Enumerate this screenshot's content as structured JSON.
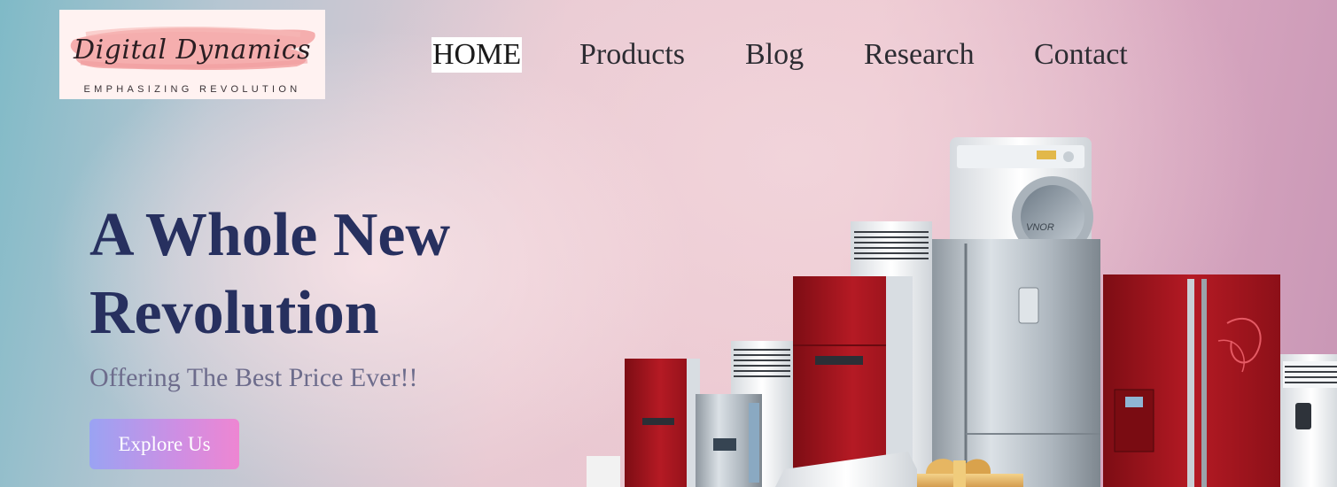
{
  "logo": {
    "script_text": "Digital Dynamics",
    "tagline": "EMPHASIZING REVOLUTION"
  },
  "nav": {
    "items": [
      {
        "label": "HOME",
        "active": true
      },
      {
        "label": "Products",
        "active": false
      },
      {
        "label": "Blog",
        "active": false
      },
      {
        "label": "Research",
        "active": false
      },
      {
        "label": "Contact",
        "active": false
      }
    ]
  },
  "hero": {
    "title_line1": "A Whole New",
    "title_line2": "Revolution",
    "subtitle": "Offering The Best Price Ever!!",
    "cta_label": "Explore Us"
  },
  "image": {
    "washer_brand": "VNOR"
  },
  "colors": {
    "title": "#27305f",
    "subtitle": "#6d6c8c",
    "cta_start": "#9aa3f3",
    "cta_end": "#ee86d2",
    "fridge_red": "#a3151f",
    "steel": "#b9c2ca"
  }
}
